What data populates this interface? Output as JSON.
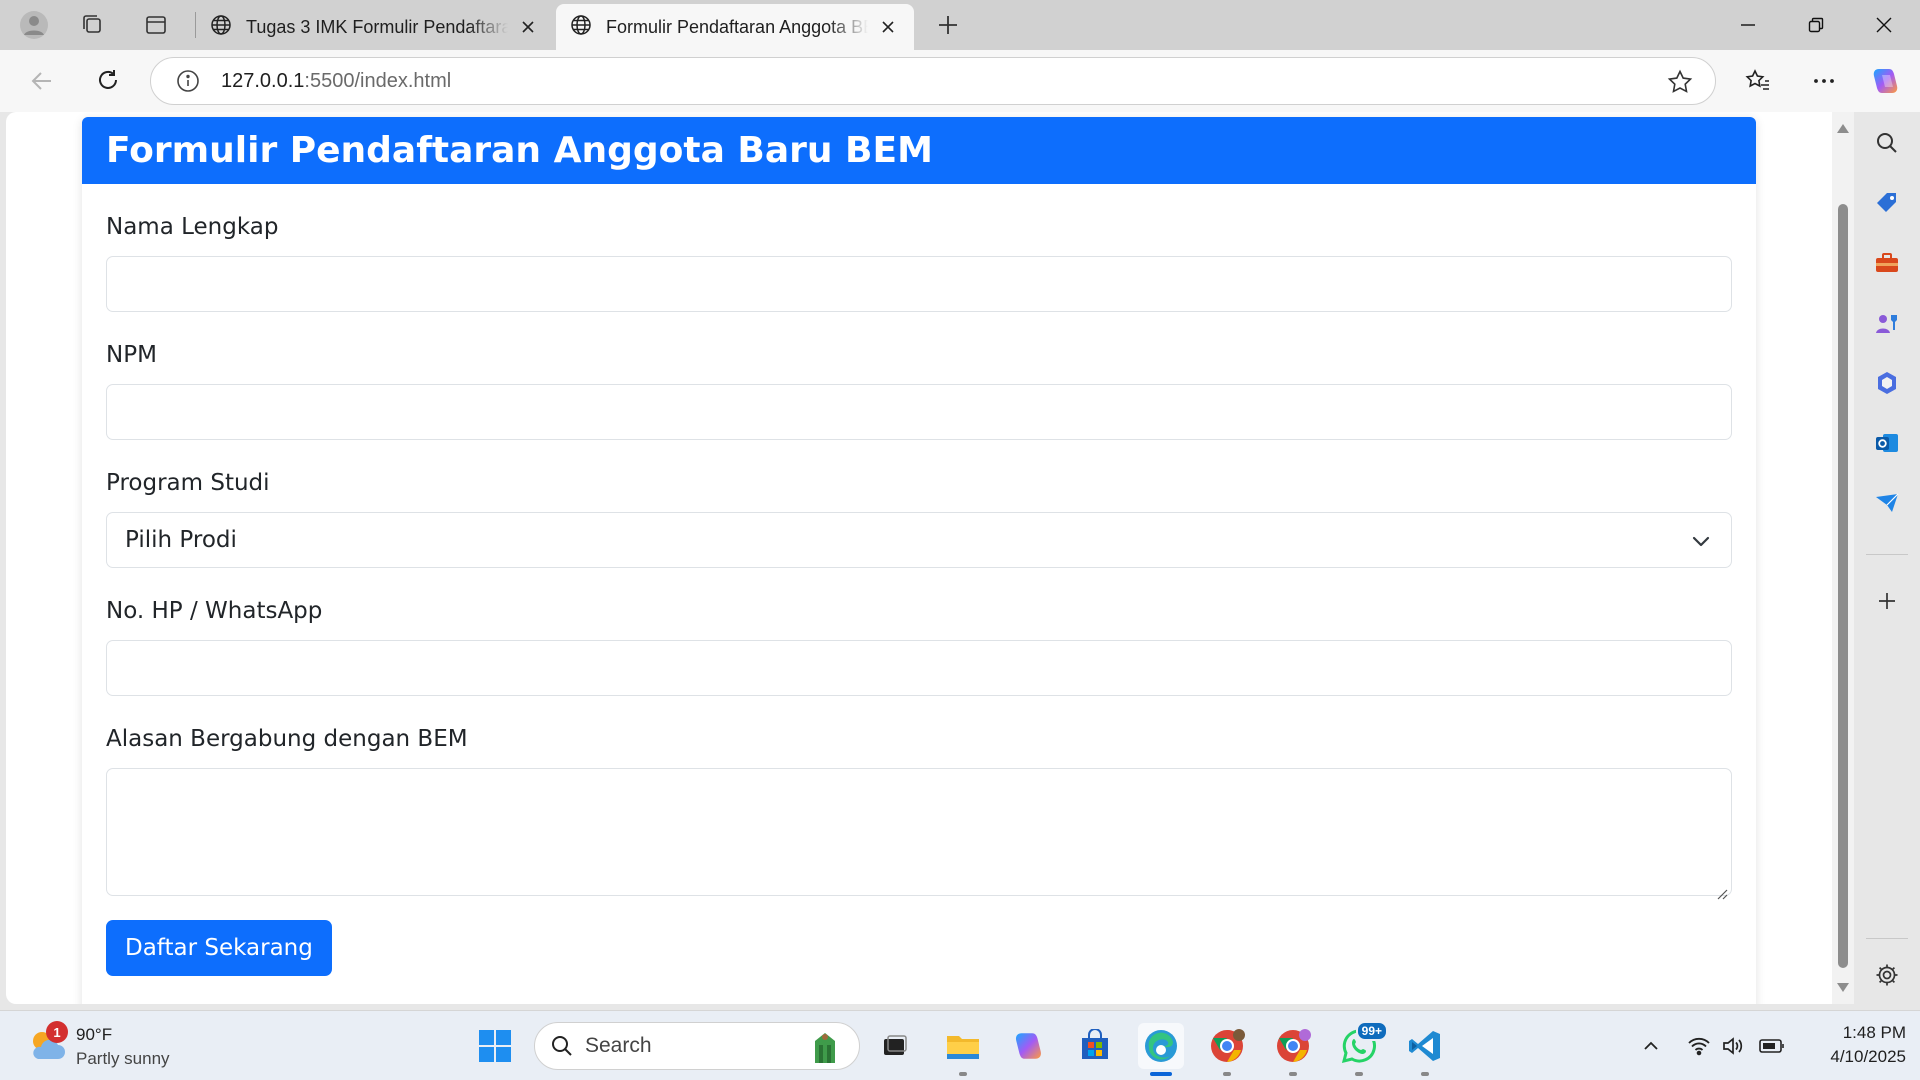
{
  "browser": {
    "tabs": [
      {
        "title": "Tugas 3 IMK Formulir Pendaftaran",
        "active": false
      },
      {
        "title": "Formulir Pendaftaran Anggota BEM",
        "active": true
      }
    ],
    "address": {
      "host": "127.0.0.1",
      "rest": ":5500/index.html"
    }
  },
  "page": {
    "header_title": "Formulir Pendaftaran Anggota Baru BEM",
    "fields": {
      "nama_label": "Nama Lengkap",
      "nama_value": "",
      "npm_label": "NPM",
      "npm_value": "",
      "prodi_label": "Program Studi",
      "prodi_selected": "Pilih Prodi",
      "hp_label": "No. HP / WhatsApp",
      "hp_value": "",
      "alasan_label": "Alasan Bergabung dengan BEM",
      "alasan_value": ""
    },
    "submit_label": "Daftar Sekarang",
    "colors": {
      "primary": "#0d6efd"
    }
  },
  "taskbar": {
    "weather": {
      "temp": "90°F",
      "desc": "Partly sunny",
      "badge": "1"
    },
    "search_label": "Search",
    "whatsapp_badge": "99+",
    "clock": {
      "time": "1:48 PM",
      "date": "4/10/2025"
    }
  }
}
